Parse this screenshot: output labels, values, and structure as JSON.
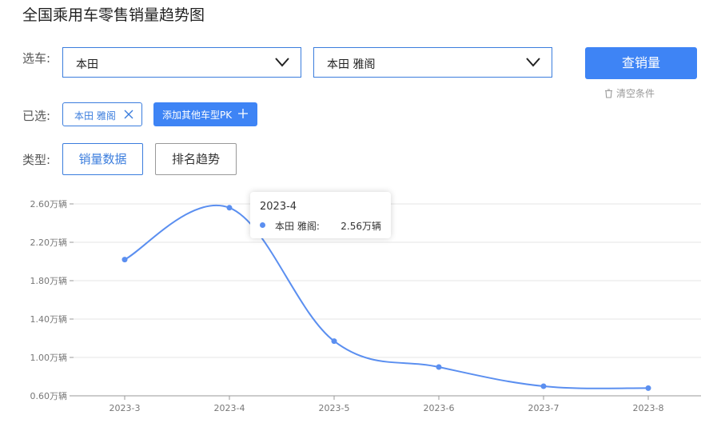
{
  "page_title": "全国乘用车零售销量趋势图",
  "filters": {
    "car_label": "选车:",
    "brand_value": "本田",
    "model_value": "本田 雅阁",
    "query_button": "查销量",
    "clear_label": "清空条件"
  },
  "selected": {
    "label": "已选:",
    "tag": "本田 雅阁",
    "add_button": "添加其他车型PK"
  },
  "types": {
    "label": "类型:",
    "active": "销量数据",
    "other": "排名趋势"
  },
  "tooltip": {
    "x": "2023-4",
    "series": "本田 雅阁:",
    "value": "2.56万辆"
  },
  "colors": {
    "accent": "#3e84f5",
    "line": "#5b8ff0"
  },
  "chart_data": {
    "type": "line",
    "categories": [
      "2023-3",
      "2023-4",
      "2023-5",
      "2023-6",
      "2023-7",
      "2023-8"
    ],
    "series": [
      {
        "name": "本田 雅阁",
        "values": [
          2.02,
          2.56,
          1.17,
          0.9,
          0.7,
          0.68
        ]
      }
    ],
    "y_ticks": [
      0.6,
      1.0,
      1.4,
      1.8,
      2.2,
      2.6
    ],
    "y_tick_labels": [
      "0.60万辆",
      "1.00万辆",
      "1.40万辆",
      "1.80万辆",
      "2.20万辆",
      "2.60万辆"
    ],
    "ylim": [
      0.6,
      2.6
    ],
    "grid": true,
    "smooth": true
  }
}
